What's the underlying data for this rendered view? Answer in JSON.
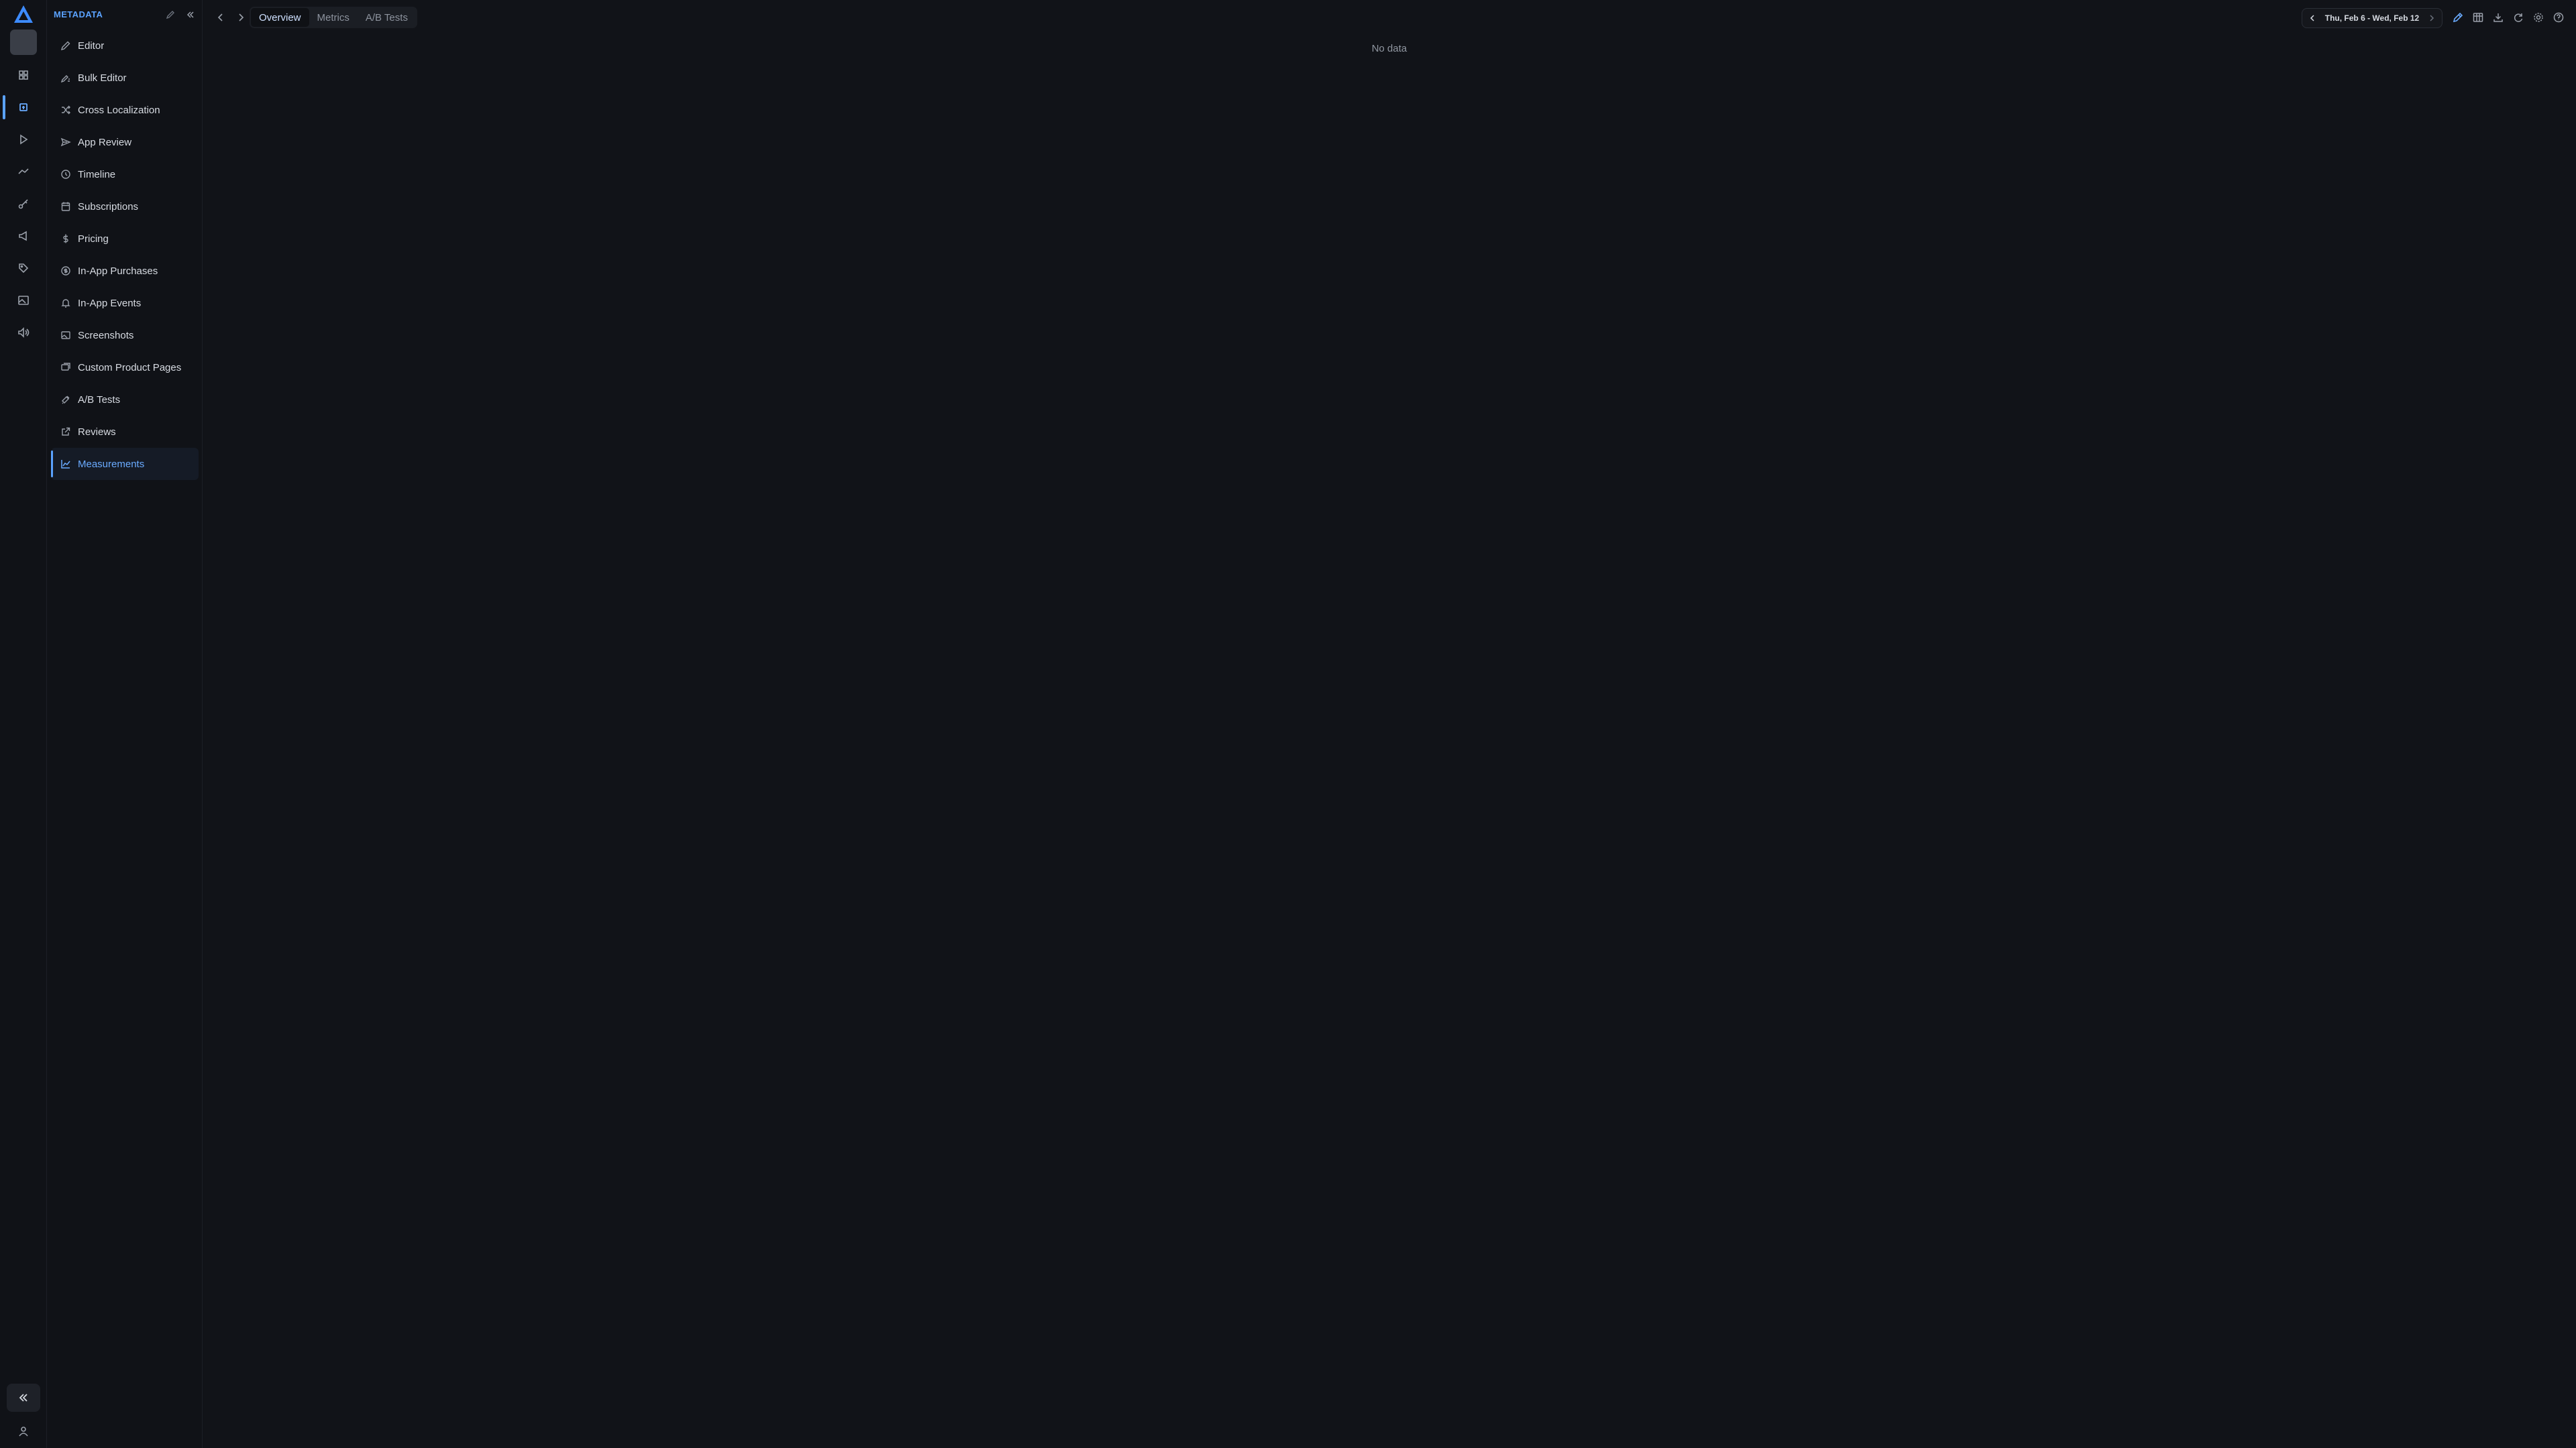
{
  "rail": {
    "items": [
      {
        "icon": "grid-icon"
      },
      {
        "icon": "app-store-icon"
      },
      {
        "icon": "play-icon"
      },
      {
        "icon": "trend-line-icon"
      },
      {
        "icon": "key-icon"
      },
      {
        "icon": "megaphone-icon"
      },
      {
        "icon": "tag-icon"
      },
      {
        "icon": "image-icon"
      },
      {
        "icon": "volume-icon"
      }
    ],
    "active_index": 1
  },
  "sidebar": {
    "section_title": "METADATA",
    "items": [
      {
        "label": "Editor",
        "icon": "pencil-icon"
      },
      {
        "label": "Bulk Editor",
        "icon": "pencil-lines-icon"
      },
      {
        "label": "Cross Localization",
        "icon": "shuffle-icon"
      },
      {
        "label": "App Review",
        "icon": "send-icon"
      },
      {
        "label": "Timeline",
        "icon": "clock-icon"
      },
      {
        "label": "Subscriptions",
        "icon": "calendar-icon"
      },
      {
        "label": "Pricing",
        "icon": "dollar-icon"
      },
      {
        "label": "In-App Purchases",
        "icon": "coin-icon"
      },
      {
        "label": "In-App Events",
        "icon": "bell-icon"
      },
      {
        "label": "Screenshots",
        "icon": "image-icon"
      },
      {
        "label": "Custom Product Pages",
        "icon": "layers-icon"
      },
      {
        "label": "A/B Tests",
        "icon": "flask-icon"
      },
      {
        "label": "Reviews",
        "icon": "external-link-icon"
      },
      {
        "label": "Measurements",
        "icon": "line-chart-icon"
      }
    ],
    "active_index": 13
  },
  "topbar": {
    "tabs": [
      "Overview",
      "Metrics",
      "A/B Tests"
    ],
    "active_tab": 0,
    "date_range": "Thu, Feb 6 - Wed, Feb 12"
  },
  "main": {
    "empty_message": "No data"
  },
  "colors": {
    "background": "#111318",
    "accent": "#5aa2ff",
    "text": "#d7dbe2",
    "muted": "#8d939e"
  }
}
